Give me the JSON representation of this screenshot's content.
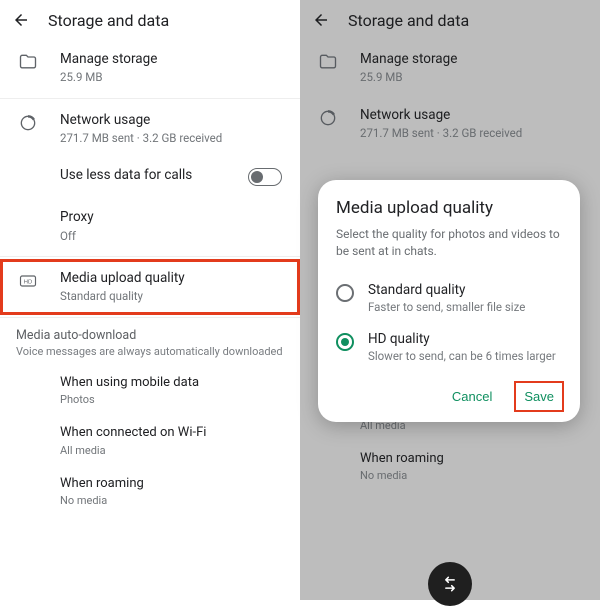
{
  "header": {
    "title": "Storage and data"
  },
  "rows": {
    "manage_storage": {
      "title": "Manage storage",
      "sub": "25.9 MB"
    },
    "network_usage": {
      "title": "Network usage",
      "sub": "271.7 MB sent · 3.2 GB received"
    },
    "use_less_data": {
      "title": "Use less data for calls"
    },
    "proxy": {
      "title": "Proxy",
      "sub": "Off"
    },
    "media_upload": {
      "title": "Media upload quality",
      "sub": "Standard quality"
    }
  },
  "section": {
    "label": "Media auto-download",
    "desc": "Voice messages are always automatically downloaded"
  },
  "autodl": {
    "mobile": {
      "title": "When using mobile data",
      "sub": "Photos"
    },
    "wifi": {
      "title": "When connected on Wi-Fi",
      "sub": "All media"
    },
    "roaming": {
      "title": "When roaming",
      "sub": "No media"
    }
  },
  "dialog": {
    "title": "Media upload quality",
    "desc": "Select the quality for photos and videos to be sent at in chats.",
    "options": {
      "standard": {
        "title": "Standard quality",
        "sub": "Faster to send, smaller file size"
      },
      "hd": {
        "title": "HD quality",
        "sub": "Slower to send, can be 6 times larger"
      }
    },
    "cancel": "Cancel",
    "save": "Save"
  }
}
